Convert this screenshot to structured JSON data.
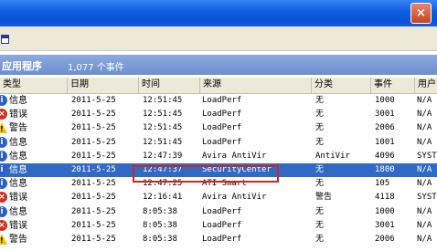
{
  "window": {
    "close_glyph": "×"
  },
  "pane": {
    "title": "应用程序",
    "count": "1,077 个事件"
  },
  "columns": [
    "类型",
    "日期",
    "时间",
    "来源",
    "分类",
    "事件",
    "用户"
  ],
  "rows": [
    {
      "type": "信息",
      "kind": "info",
      "date": "2011-5-25",
      "time": "12:51:45",
      "source": "LoadPerf",
      "category": "无",
      "event": "1000",
      "user": "N/A"
    },
    {
      "type": "错误",
      "kind": "error",
      "date": "2011-5-25",
      "time": "12:51:45",
      "source": "LoadPerf",
      "category": "无",
      "event": "3001",
      "user": "N/A"
    },
    {
      "type": "警告",
      "kind": "warn",
      "date": "2011-5-25",
      "time": "12:51:45",
      "source": "LoadPerf",
      "category": "无",
      "event": "2006",
      "user": "N/A"
    },
    {
      "type": "信息",
      "kind": "info",
      "date": "2011-5-25",
      "time": "12:51:45",
      "source": "LoadPerf",
      "category": "无",
      "event": "1001",
      "user": "N/A"
    },
    {
      "type": "信息",
      "kind": "info",
      "date": "2011-5-25",
      "time": "12:47:39",
      "source": "Avira AntiVir",
      "category": "AntiVir",
      "event": "4096",
      "user": "SYST"
    },
    {
      "type": "信息",
      "kind": "info",
      "date": "2011-5-25",
      "time": "12:47:37",
      "source": "SecurityCenter",
      "category": "无",
      "event": "1800",
      "user": "N/A",
      "selected": true
    },
    {
      "type": "信息",
      "kind": "info",
      "date": "2011-5-25",
      "time": "12:47:25",
      "source": "ATI Smart",
      "category": "无",
      "event": "105",
      "user": "N/A"
    },
    {
      "type": "错误",
      "kind": "error",
      "date": "2011-5-25",
      "time": "12:16:41",
      "source": "Avira AntiVir",
      "category": "警告",
      "event": "4118",
      "user": "SYST"
    },
    {
      "type": "信息",
      "kind": "info",
      "date": "2011-5-25",
      "time": "8:05:38",
      "source": "LoadPerf",
      "category": "无",
      "event": "1000",
      "user": "N/A"
    },
    {
      "type": "错误",
      "kind": "error",
      "date": "2011-5-25",
      "time": "8:05:38",
      "source": "LoadPerf",
      "category": "无",
      "event": "3001",
      "user": "N/A"
    },
    {
      "type": "警告",
      "kind": "warn",
      "date": "2011-5-25",
      "time": "8:05:38",
      "source": "LoadPerf",
      "category": "无",
      "event": "2006",
      "user": "N/A"
    }
  ]
}
